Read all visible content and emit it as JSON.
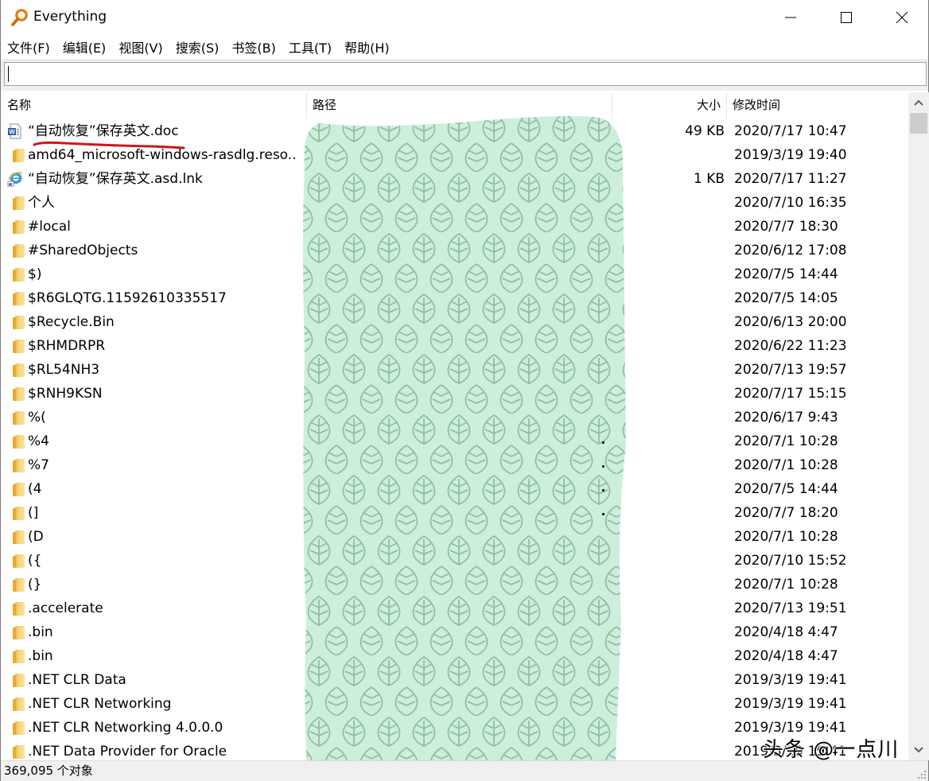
{
  "window": {
    "title": "Everything",
    "icon": "magnifier-icon",
    "controls": [
      "minimize",
      "maximize",
      "close"
    ]
  },
  "menu": [
    {
      "label": "文件(F)"
    },
    {
      "label": "编辑(E)"
    },
    {
      "label": "视图(V)"
    },
    {
      "label": "搜索(S)"
    },
    {
      "label": "书签(B)"
    },
    {
      "label": "工具(T)"
    },
    {
      "label": "帮助(H)"
    }
  ],
  "search": {
    "value": "",
    "placeholder": ""
  },
  "columns": {
    "name": "名称",
    "path": "路径",
    "size": "大小",
    "modified": "修改时间"
  },
  "rows": [
    {
      "icon": "word-doc-icon",
      "name": "“自动恢复”保存英文.doc",
      "size": "49 KB",
      "modified": "2020/7/17 10:47"
    },
    {
      "icon": "folder-icon",
      "name": "amd64_microsoft-windows-rasdlg.reso..",
      "size": "",
      "modified": "2019/3/19 19:40"
    },
    {
      "icon": "ie-shortcut-icon",
      "name": "“自动恢复”保存英文.asd.lnk",
      "size": "1 KB",
      "modified": "2020/7/17 11:27"
    },
    {
      "icon": "folder-icon",
      "name": "个人",
      "size": "",
      "modified": "2020/7/10 16:35"
    },
    {
      "icon": "folder-icon",
      "name": "#local",
      "size": "",
      "modified": "2020/7/7 18:30"
    },
    {
      "icon": "folder-icon",
      "name": "#SharedObjects",
      "size": "",
      "modified": "2020/6/12 17:08"
    },
    {
      "icon": "folder-icon",
      "name": "$)",
      "size": "",
      "modified": "2020/7/5 14:44"
    },
    {
      "icon": "folder-icon",
      "name": "$R6GLQTG.11592610335517",
      "size": "",
      "modified": "2020/7/5 14:05"
    },
    {
      "icon": "folder-icon",
      "name": "$Recycle.Bin",
      "size": "",
      "modified": "2020/6/13 20:00"
    },
    {
      "icon": "folder-icon",
      "name": "$RHMDRPR",
      "size": "",
      "modified": "2020/6/22 11:23"
    },
    {
      "icon": "folder-icon",
      "name": "$RL54NH3",
      "size": "",
      "modified": "2020/7/13 19:57"
    },
    {
      "icon": "folder-icon",
      "name": "$RNH9KSN",
      "size": "",
      "modified": "2020/7/17 15:15"
    },
    {
      "icon": "folder-icon",
      "name": "%(",
      "size": "",
      "modified": "2020/6/17 9:43"
    },
    {
      "icon": "folder-icon",
      "name": "%4",
      "size": "",
      "modified": "2020/7/1 10:28"
    },
    {
      "icon": "folder-icon",
      "name": "%7",
      "size": "",
      "modified": "2020/7/1 10:28"
    },
    {
      "icon": "folder-icon",
      "name": "(4",
      "size": "",
      "modified": "2020/7/5 14:44"
    },
    {
      "icon": "folder-icon",
      "name": "(]",
      "size": "",
      "modified": "2020/7/7 18:20"
    },
    {
      "icon": "folder-icon",
      "name": "(D",
      "size": "",
      "modified": "2020/7/1 10:28"
    },
    {
      "icon": "folder-icon",
      "name": "({",
      "size": "",
      "modified": "2020/7/10 15:52"
    },
    {
      "icon": "folder-icon",
      "name": "(}",
      "size": "",
      "modified": "2020/7/1 10:28"
    },
    {
      "icon": "folder-icon",
      "name": ".accelerate",
      "size": "",
      "modified": "2020/7/13 19:51"
    },
    {
      "icon": "folder-icon",
      "name": ".bin",
      "size": "",
      "modified": "2020/4/18 4:47"
    },
    {
      "icon": "folder-icon",
      "name": ".bin",
      "size": "",
      "modified": "2020/4/18 4:47"
    },
    {
      "icon": "folder-icon",
      "name": ".NET CLR Data",
      "size": "",
      "modified": "2019/3/19 19:41"
    },
    {
      "icon": "folder-icon",
      "name": ".NET CLR Networking",
      "size": "",
      "modified": "2019/3/19 19:41"
    },
    {
      "icon": "folder-icon",
      "name": ".NET CLR Networking 4.0.0.0",
      "size": "",
      "modified": "2019/3/19 19:41"
    },
    {
      "icon": "folder-icon",
      "name": ".NET Data Provider for Oracle",
      "size": "",
      "modified": "2019/3/19 19:41"
    }
  ],
  "status": {
    "count": "369,095 个对象"
  },
  "overlay": {
    "description": "green leaf pattern redaction covering path column",
    "fill": "#cdeedb",
    "stroke": "#8fbfa3"
  },
  "annotation": {
    "color": "#d0161b"
  },
  "watermark": "头条 @一点川"
}
